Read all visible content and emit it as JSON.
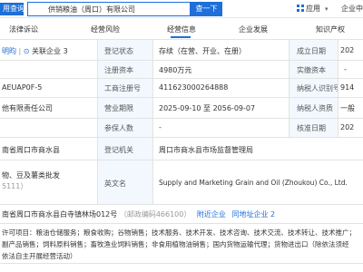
{
  "top": {
    "brand": "用查询",
    "search_value": "供销粮油（周口）有限公司",
    "search_button": "查一下",
    "app_label": "应用",
    "center_link": "企业中"
  },
  "tabs": [
    "法律诉讼",
    "经营风险",
    "经营信息",
    "企业发展",
    "知识产权"
  ],
  "active_tab_index": 2,
  "left_col": {
    "person_name": "明昀",
    "related": "关联企业 3",
    "credit_code_partial": "AEUAP0F-5",
    "company_type_partial": "他有限责任公司",
    "address_partial": "南省周口市商水县",
    "business_partial": "物、豆及薯类批发",
    "business_code": "5111）"
  },
  "rows": [
    {
      "label": "登记状态",
      "value": "存续（在营、开业、在册）",
      "label2": "成立日期",
      "value2": "202"
    },
    {
      "label": "注册资本",
      "value": "4980万元",
      "label2": "实缴资本",
      "value2": "-"
    },
    {
      "label": "工商注册号",
      "value": "411623000264888",
      "label2": "纳税人识别号",
      "value2": "914"
    },
    {
      "label": "营业期限",
      "value": "2025-09-10 至 2056-09-07",
      "label2": "纳税人资质",
      "value2": "一般"
    },
    {
      "label": "参保人数",
      "value": "-",
      "label2": "核准日期",
      "value2": "202"
    },
    {
      "label": "登记机关",
      "value": "周口市商水县市场监督管理局"
    },
    {
      "label": "英文名",
      "value": "Supply and Marketing Grain and Oil (Zhoukou) Co., Ltd."
    }
  ],
  "address_row": {
    "address": "南省周口市商水县白寺镇林场012号",
    "postcode": "（邮政编码466100）",
    "nearby": "附近企业",
    "same_address": "同地址企业 2"
  },
  "scope_lines": [
    "许可项目：粮油仓储服务；粮食收购；谷物销售；技术服务、技术开发、技术咨询、技术交流、技术转让、技术推广；",
    "副产品销售；饲料原料销售；畜牧渔业饲料销售；非食用植物油销售；国内货物运输代理；货物进出口（除依法须经",
    "依法自主开展经营活动）"
  ]
}
